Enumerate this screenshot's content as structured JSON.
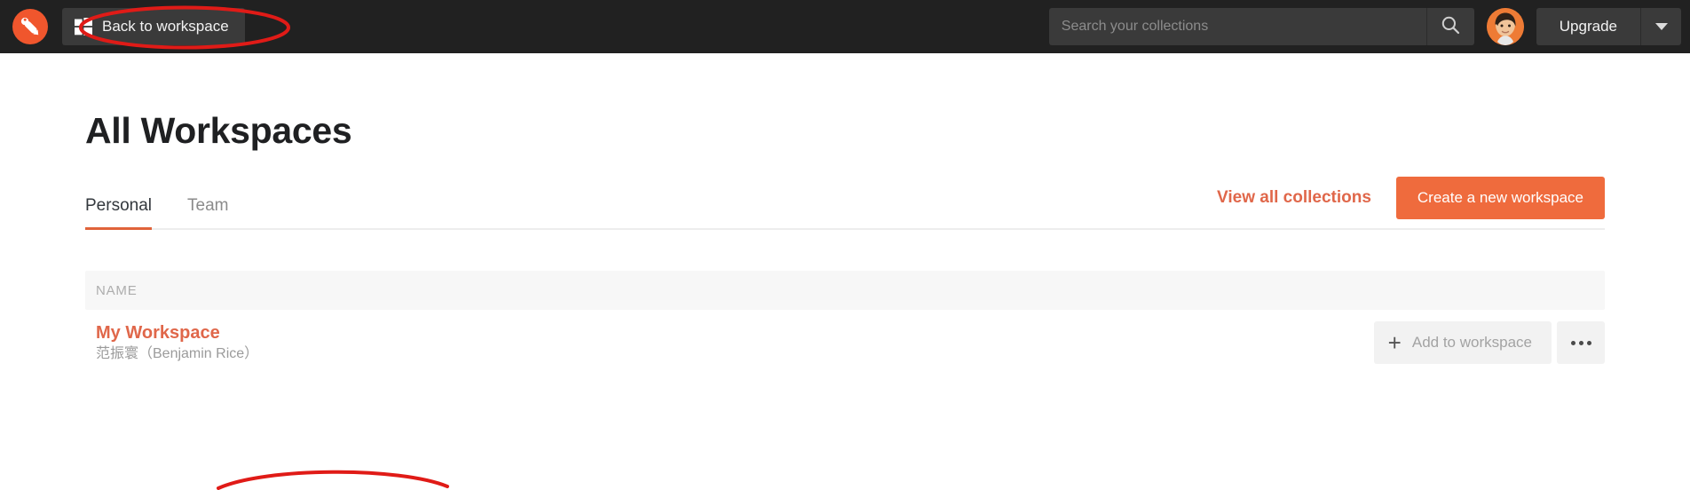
{
  "topbar": {
    "logo_icon": "postman-rocket-icon",
    "back_button": {
      "label": "Back to workspace",
      "icon": "windows-grid-icon"
    },
    "search": {
      "placeholder": "Search your collections",
      "value": "",
      "icon": "search-icon"
    },
    "avatar_alt": "user-avatar",
    "upgrade_label": "Upgrade",
    "caret_icon": "chevron-down-icon",
    "background_color": "#212121",
    "control_color": "#3a3a3a"
  },
  "main": {
    "title": "All Workspaces",
    "tabs": [
      {
        "label": "Personal",
        "active": true
      },
      {
        "label": "Team",
        "active": false
      }
    ],
    "actions": {
      "view_all_label": "View all collections",
      "create_label": "Create a new workspace"
    },
    "table": {
      "columns": [
        "NAME"
      ],
      "rows": [
        {
          "name": "My Workspace",
          "subtitle": "范振寰（Benjamin Rice）",
          "add_label": "Add to workspace",
          "add_icon": "plus-icon",
          "more_icon": "ellipsis-icon"
        }
      ]
    }
  },
  "annotations": {
    "ellipse_back_to_workspace": "red-ellipse-highlight",
    "arc_bottom": "red-arc-highlight"
  },
  "colors": {
    "accent": "#ef6b3d",
    "link": "#e0674a",
    "annotation": "#e01b17",
    "tab_underline": "#e0633a"
  }
}
